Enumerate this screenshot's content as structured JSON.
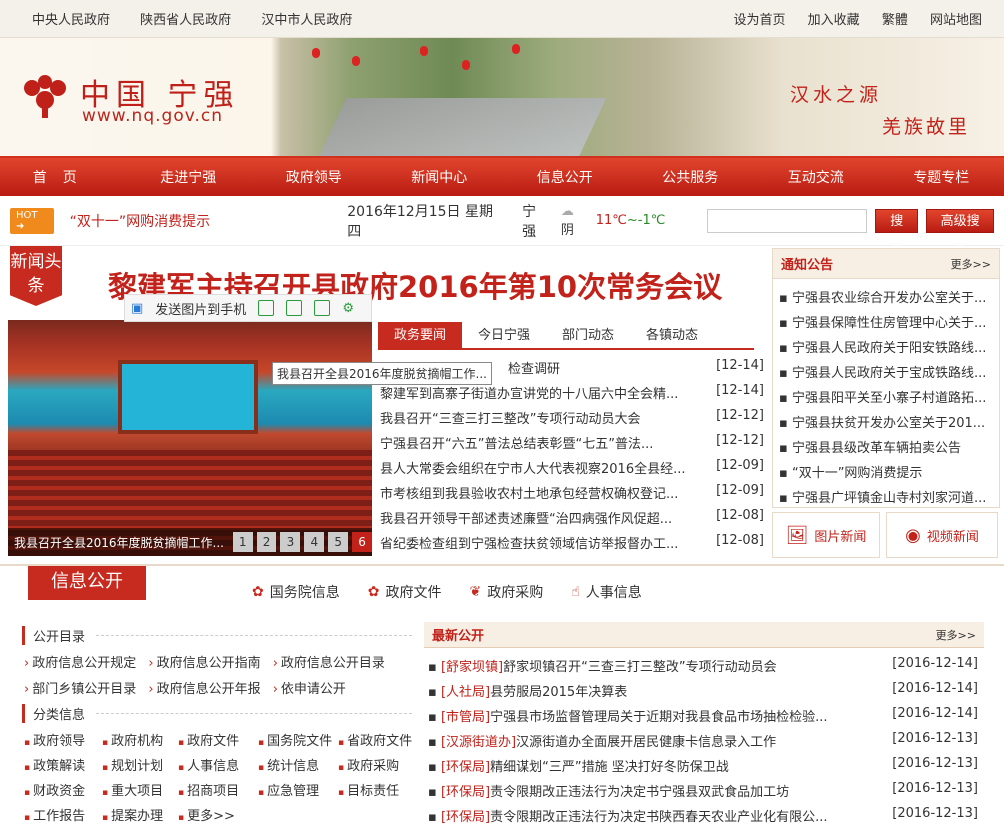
{
  "topbar": {
    "left": [
      "中央人民政府",
      "陕西省人民政府",
      "汉中市人民政府"
    ],
    "right": [
      "设为首页",
      "加入收藏",
      "繁體",
      "网站地图"
    ]
  },
  "banner": {
    "logo_text": "中国 宁强",
    "url": "www.nq.gov.cn",
    "slogan1": "汉水之源",
    "slogan2": "羌族故里"
  },
  "nav": [
    "首页",
    "走进宁强",
    "政府领导",
    "新闻中心",
    "信息公开",
    "公共服务",
    "互动交流",
    "专题专栏"
  ],
  "infobar": {
    "hot_label": "HOT",
    "notice": "“双十一”网购消费提示",
    "date": "2016年12月15日 星期四",
    "city": "宁强",
    "weather": "阴",
    "temp_high": "11℃",
    "temp_low": "~-1℃",
    "search_btn": "搜索",
    "adv_search_btn": "高级搜索"
  },
  "headline": {
    "badge": "新闻头条",
    "title": "黎建军主持召开县政府2016年第10次常务会议"
  },
  "toolbar": {
    "send": "发送图片到手机"
  },
  "slideshow": {
    "caption": "我县召开全县2016年度脱贫摘帽工作...",
    "tooltip": "我县召开全县2016年度脱贫摘帽工作...",
    "pages": [
      "1",
      "2",
      "3",
      "4",
      "5",
      "6"
    ],
    "active_page": "6"
  },
  "tabs": [
    "政务要闻",
    "今日宁强",
    "部门动态",
    "各镇动态"
  ],
  "news": [
    {
      "title": "检查调研",
      "date": "[12-14]"
    },
    {
      "title": "黎建军到高寨子街道办宣讲党的十八届六中全会精...",
      "date": "[12-14]"
    },
    {
      "title": "我县召开“三查三打三整改”专项行动动员大会",
      "date": "[12-12]"
    },
    {
      "title": "宁强县召开“六五”普法总结表彰暨“七五”普法...",
      "date": "[12-12]"
    },
    {
      "title": "县人大常委会组织在宁市人大代表视察2016全县经...",
      "date": "[12-09]"
    },
    {
      "title": "市考核组到我县验收农村土地承包经营权确权登记...",
      "date": "[12-09]"
    },
    {
      "title": "我县召开领导干部述责述廉暨“治四病强作风促超...",
      "date": "[12-08]"
    },
    {
      "title": "省纪委检查组到宁强检查扶贫领域信访举报督办工...",
      "date": "[12-08]"
    }
  ],
  "notices": {
    "title": "通知公告",
    "more": "更多>>",
    "items": [
      "宁强县农业综合开发办公室关于...",
      "宁强县保障性住房管理中心关于...",
      "宁强县人民政府关于阳安铁路线...",
      "宁强县人民政府关于宝成铁路线...",
      "宁强县阳平关至小寨子村道路拓...",
      "宁强县扶贫开发办公室关于201...",
      "宁强县县级改革车辆拍卖公告",
      "“双十一”网购消费提示",
      "宁强县广坪镇金山寺村刘家河道..."
    ]
  },
  "media": {
    "photo": "图片新闻",
    "video": "视频新闻"
  },
  "info": {
    "title": "信息公开",
    "cats": [
      "国务院信息",
      "政府文件",
      "政府采购",
      "人事信息"
    ],
    "catalog_title": "公开目录",
    "catalog_links": [
      "政府信息公开规定",
      "政府信息公开指南",
      "政府信息公开目录",
      "部门乡镇公开目录",
      "政府信息公开年报",
      "依申请公开"
    ],
    "class_title": "分类信息",
    "class_items": [
      "政府领导",
      "政府机构",
      "政府文件",
      "国务院文件",
      "省政府文件",
      "政策解读",
      "规划计划",
      "人事信息",
      "统计信息",
      "政府采购",
      "财政资金",
      "重大项目",
      "招商项目",
      "应急管理",
      "目标责任",
      "工作报告",
      "提案办理",
      "更多>>"
    ],
    "latest_title": "最新公开",
    "latest_more": "更多>>",
    "latest": [
      {
        "tag": "[舒家坝镇]",
        "title": "舒家坝镇召开“三查三打三整改”专项行动动员会",
        "date": "[2016-12-14]"
      },
      {
        "tag": "[人社局]",
        "title": "县劳服局2015年决算表",
        "date": "[2016-12-14]"
      },
      {
        "tag": "[市管局]",
        "title": "宁强县市场监督管理局关于近期对我县食品市场抽检检验...",
        "date": "[2016-12-14]"
      },
      {
        "tag": "[汉源街道办]",
        "title": "汉源街道办全面展开居民健康卡信息录入工作",
        "date": "[2016-12-13]"
      },
      {
        "tag": "[环保局]",
        "title": "精细谋划“三严”措施 坚决打好冬防保卫战",
        "date": "[2016-12-13]"
      },
      {
        "tag": "[环保局]",
        "title": "责令限期改正违法行为决定书宁强县双武食品加工坊",
        "date": "[2016-12-13]"
      },
      {
        "tag": "[环保局]",
        "title": "责令限期改正违法行为决定书陕西春天农业产业化有限公...",
        "date": "[2016-12-13]"
      }
    ]
  }
}
